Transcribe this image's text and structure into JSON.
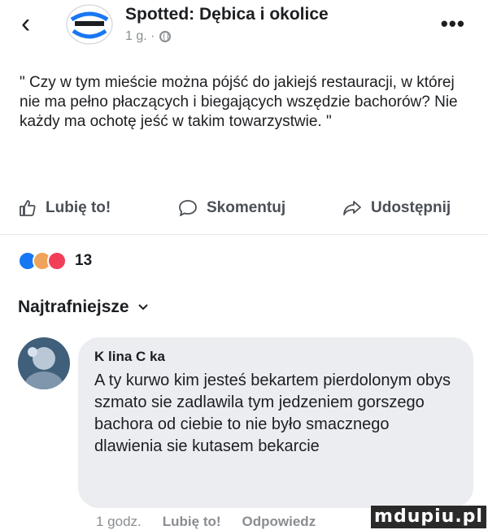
{
  "header": {
    "page_name": "Spotted: Dębica i okolice",
    "time": "1 g. ·",
    "back_icon": "chevron-left-icon",
    "more_icon": "more-horizontal-icon"
  },
  "post": {
    "text": "\" Czy w tym mieście można pójść do jakiejś restauracji, w której nie ma pełno płaczących i biegających wszędzie bachorów? Nie każdy ma ochotę jeść w takim towarzystwie. \""
  },
  "actions": {
    "like": "Lubię to!",
    "comment": "Skomentuj",
    "share": "Udostępnij"
  },
  "reactions": {
    "count": "13",
    "types": [
      "like",
      "angry",
      "love"
    ]
  },
  "sort": {
    "label": "Najtrafniejsze"
  },
  "comment": {
    "author": "K  lina C    ka",
    "text": "A ty kurwo kim jesteś bekartem pierdolonym obys szmato sie zadlawila tym jedzeniem gorszego bachora od ciebie to nie było smacznego dlawienia sie kutasem bekarcie",
    "time": "1 godz.",
    "like": "Lubię to!",
    "reply": "Odpowiedz"
  },
  "watermark": {
    "text": "mdupiu.pl"
  },
  "colors": {
    "accent": "#1877f2",
    "text": "#1c1e21",
    "muted": "#8a8d91",
    "bubble": "#ecedf0"
  }
}
